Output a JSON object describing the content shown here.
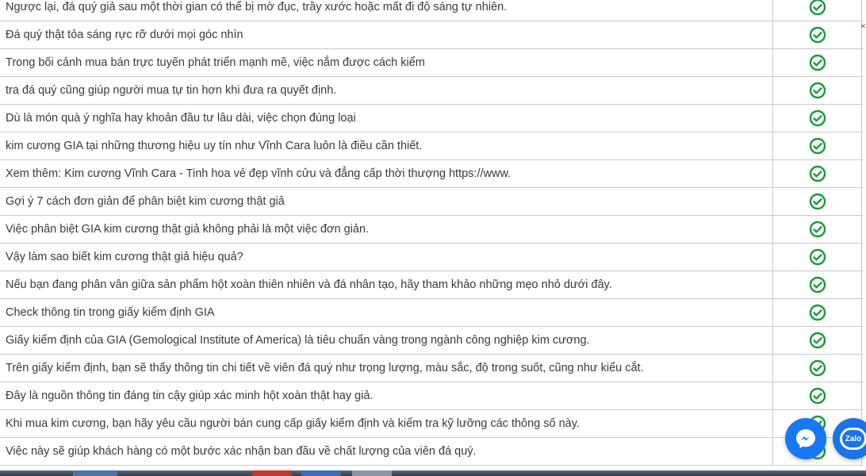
{
  "table": {
    "rows": [
      {
        "text": "Ngược lại, đá quý giả sau một thời gian có thể bị mờ đục, trầy xước hoặc mất đi độ sáng tự nhiên."
      },
      {
        "text": "Đá quý thật tỏa sáng rực rỡ dưới mọi góc nhìn"
      },
      {
        "text": "Trong bối cảnh mua bán trực tuyến phát triển mạnh mẽ, việc nắm được cách kiểm"
      },
      {
        "text": "tra đá quý cũng giúp người mua tự tin hơn khi đưa ra quyết định."
      },
      {
        "text": "Dù là món quà ý nghĩa hay khoản đầu tư lâu dài, việc chọn đúng loại"
      },
      {
        "text": "kim cương GIA tại những thương hiệu uy tín như Vĩnh Cara luôn là điều cần thiết."
      },
      {
        "text": "Xem thêm: Kim cương Vĩnh Cara - Tinh hoa vẻ đẹp vĩnh cửu và đẳng cấp thời thượng https://www."
      },
      {
        "text": "Gợi ý 7 cách đơn giản để phân biệt kim cương thật giả"
      },
      {
        "text": "Việc phân biệt GIA kim cương thật giả không phải là một việc đơn giản."
      },
      {
        "text": "Vậy làm sao biết kim cương thật giả hiệu quả?"
      },
      {
        "text": "Nếu bạn đang phân vân giữa sản phẩm hột xoàn thiên nhiên và đá nhân tạo, hãy tham khảo những mẹo nhỏ dưới đây."
      },
      {
        "text": "Check thông tin trong giấy kiểm định GIA"
      },
      {
        "text": "Giấy kiểm định của GIA (Gemological Institute of America) là tiêu chuẩn vàng trong ngành công nghiệp kim cương."
      },
      {
        "text": "Trên giấy kiểm định, bạn sẽ thấy thông tin chi tiết về viên đá quý như trọng lượng, màu sắc, độ trong suốt, cũng như kiểu cắt."
      },
      {
        "text": "Đây là nguồn thông tin đáng tin cậy giúp xác minh hột xoàn thật hay giả."
      },
      {
        "text": "Khi mua kim cương, bạn hãy yêu cầu người bán cung cấp giấy kiểm định và kiểm tra kỹ lưỡng các thông số này."
      },
      {
        "text": "Việc này sẽ giúp khách hàng có một bước xác nhận ban đầu về chất lượng của viên đá quý."
      }
    ],
    "check_color": "#1a9a3c"
  },
  "floating": {
    "zalo_label": "Zalo",
    "messenger_color": "#1877f2",
    "zalo_color": "#1a73e8"
  }
}
